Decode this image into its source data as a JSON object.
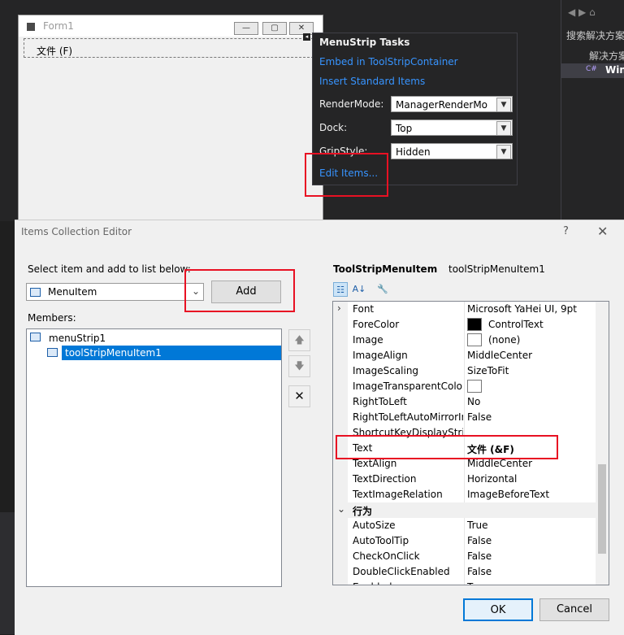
{
  "form": {
    "title": "Form1",
    "menu_item": "文件 (F)",
    "minimize_glyph": "—",
    "maximize_glyph": "▢",
    "close_glyph": "✕",
    "smart_tag_glyph": "◂"
  },
  "tasks": {
    "header": "MenuStrip Tasks",
    "link_embed": "Embed in ToolStripContainer",
    "link_insert": "Insert Standard Items",
    "render_label": "RenderMode:",
    "render_value": "ManagerRenderMo",
    "dock_label": "Dock:",
    "dock_value": "Top",
    "grip_label": "GripStyle:",
    "grip_value": "Hidden",
    "link_edit": "Edit Items..."
  },
  "dialog": {
    "title": "Items Collection Editor",
    "help_glyph": "?",
    "close_glyph": "✕",
    "select_label": "Select item and add to list below:",
    "item_type": "MenuItem",
    "add_label": "Add",
    "members_label": "Members:",
    "tree": [
      "menuStrip1",
      "toolStripMenuItem1"
    ],
    "up_glyph": "🡅",
    "down_glyph": "🡇",
    "delete_glyph": "✕",
    "selected_type": "ToolStripMenuItem",
    "selected_name": "toolStripMenuItem1",
    "ok_label": "OK",
    "cancel_label": "Cancel"
  },
  "properties": [
    {
      "name": "Font",
      "value": "Microsoft YaHei UI, 9pt",
      "expander": "›"
    },
    {
      "name": "ForeColor",
      "value": "ControlText",
      "swatch": "#000000"
    },
    {
      "name": "Image",
      "value": "(none)",
      "swatch": "#ffffff"
    },
    {
      "name": "ImageAlign",
      "value": "MiddleCenter"
    },
    {
      "name": "ImageScaling",
      "value": "SizeToFit"
    },
    {
      "name": "ImageTransparentColor",
      "value": "",
      "swatch": "#ffffff"
    },
    {
      "name": "RightToLeft",
      "value": "No"
    },
    {
      "name": "RightToLeftAutoMirrorImage",
      "value": "False"
    },
    {
      "name": "ShortcutKeyDisplayString",
      "value": ""
    },
    {
      "name": "Text",
      "value": "文件 (&F)"
    },
    {
      "name": "TextAlign",
      "value": "MiddleCenter"
    },
    {
      "name": "TextDirection",
      "value": "Horizontal"
    },
    {
      "name": "TextImageRelation",
      "value": "ImageBeforeText"
    },
    {
      "name": "行为",
      "value": "",
      "expander": "⌄"
    },
    {
      "name": "AutoSize",
      "value": "True"
    },
    {
      "name": "AutoToolTip",
      "value": "False"
    },
    {
      "name": "CheckOnClick",
      "value": "False"
    },
    {
      "name": "DoubleClickEnabled",
      "value": "False"
    },
    {
      "name": "Enabled",
      "value": "True"
    }
  ],
  "ide": {
    "search_label": "搜索解决方案",
    "sol_label": "解决方案",
    "proj_label": "Win",
    "cs_glyph": "C#"
  },
  "colors": {
    "accent": "#0078d7",
    "highlight": "#e81123",
    "link": "#3794ff"
  }
}
